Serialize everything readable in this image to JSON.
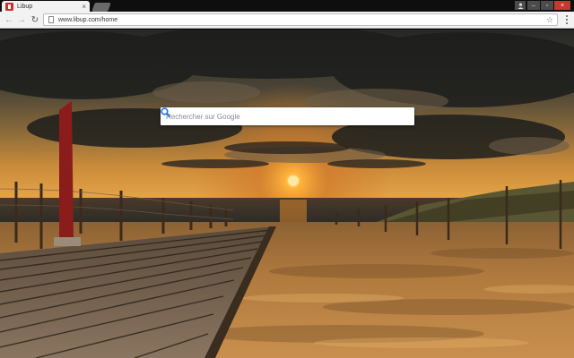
{
  "browser": {
    "tab": {
      "title": "Libup",
      "close_glyph": "×",
      "favicon": "libup-logo-icon"
    },
    "window_controls": {
      "user": "user-icon",
      "minimize": "–",
      "maximize": "▫",
      "close": "×"
    },
    "nav": {
      "back": "←",
      "forward": "→",
      "reload": "↻"
    },
    "omnibox": {
      "url": "www.libup.com/home",
      "star": "☆"
    }
  },
  "page": {
    "background": "sunset-beach-boardwalk-photo",
    "search": {
      "placeholder": "Rechercher sur Google",
      "button_icon": "search-icon",
      "accent": "#1a73e8"
    }
  }
}
